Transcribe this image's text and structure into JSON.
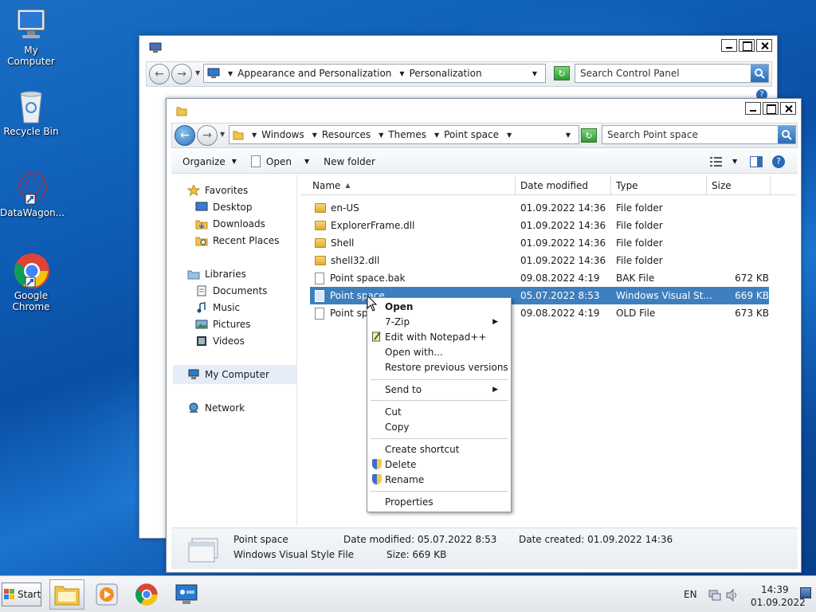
{
  "desktop": {
    "icons": [
      {
        "label": "My Computer"
      },
      {
        "label": "Recycle Bin"
      },
      {
        "label": "DataWagon..."
      },
      {
        "label": "Google Chrome"
      }
    ]
  },
  "control_panel": {
    "breadcrumb": [
      "Appearance and Personalization",
      "Personalization"
    ],
    "search_placeholder": "Search Control Panel"
  },
  "explorer": {
    "breadcrumb": [
      "Windows",
      "Resources",
      "Themes",
      "Point space"
    ],
    "search_placeholder": "Search Point space",
    "toolbar": {
      "organize": "Organize",
      "open": "Open",
      "new_folder": "New folder"
    },
    "nav": {
      "favorites": "Favorites",
      "desktop": "Desktop",
      "downloads": "Downloads",
      "recent": "Recent Places",
      "libraries": "Libraries",
      "documents": "Documents",
      "music": "Music",
      "pictures": "Pictures",
      "videos": "Videos",
      "computer": "My Computer",
      "network": "Network"
    },
    "columns": {
      "name": "Name",
      "date": "Date modified",
      "type": "Type",
      "size": "Size"
    },
    "files": [
      {
        "name": "en-US",
        "date": "01.09.2022 14:36",
        "type": "File folder",
        "size": "",
        "kind": "folder"
      },
      {
        "name": "ExplorerFrame.dll",
        "date": "01.09.2022 14:36",
        "type": "File folder",
        "size": "",
        "kind": "folder"
      },
      {
        "name": "Shell",
        "date": "01.09.2022 14:36",
        "type": "File folder",
        "size": "",
        "kind": "folder"
      },
      {
        "name": "shell32.dll",
        "date": "01.09.2022 14:36",
        "type": "File folder",
        "size": "",
        "kind": "folder"
      },
      {
        "name": "Point space.bak",
        "date": "09.08.2022 4:19",
        "type": "BAK File",
        "size": "672 KB",
        "kind": "file"
      },
      {
        "name": "Point space",
        "date": "05.07.2022 8:53",
        "type": "Windows Visual St...",
        "size": "669 KB",
        "kind": "style"
      },
      {
        "name": "Point spa",
        "date": "09.08.2022 4:19",
        "type": "OLD File",
        "size": "673 KB",
        "kind": "file"
      }
    ],
    "details": {
      "name": "Point space",
      "type": "Windows Visual Style File",
      "date_modified_label": "Date modified:",
      "date_modified": "05.07.2022 8:53",
      "size_label": "Size:",
      "size": "669 KB",
      "date_created_label": "Date created:",
      "date_created": "01.09.2022 14:36"
    }
  },
  "context_menu": {
    "open": "Open",
    "zip": "7-Zip",
    "notepad": "Edit with Notepad++",
    "open_with": "Open with...",
    "restore": "Restore previous versions",
    "send_to": "Send to",
    "cut": "Cut",
    "copy": "Copy",
    "shortcut": "Create shortcut",
    "delete": "Delete",
    "rename": "Rename",
    "properties": "Properties"
  },
  "taskbar": {
    "start": "Start",
    "lang": "EN",
    "time": "14:39",
    "date": "01.09.2022"
  }
}
